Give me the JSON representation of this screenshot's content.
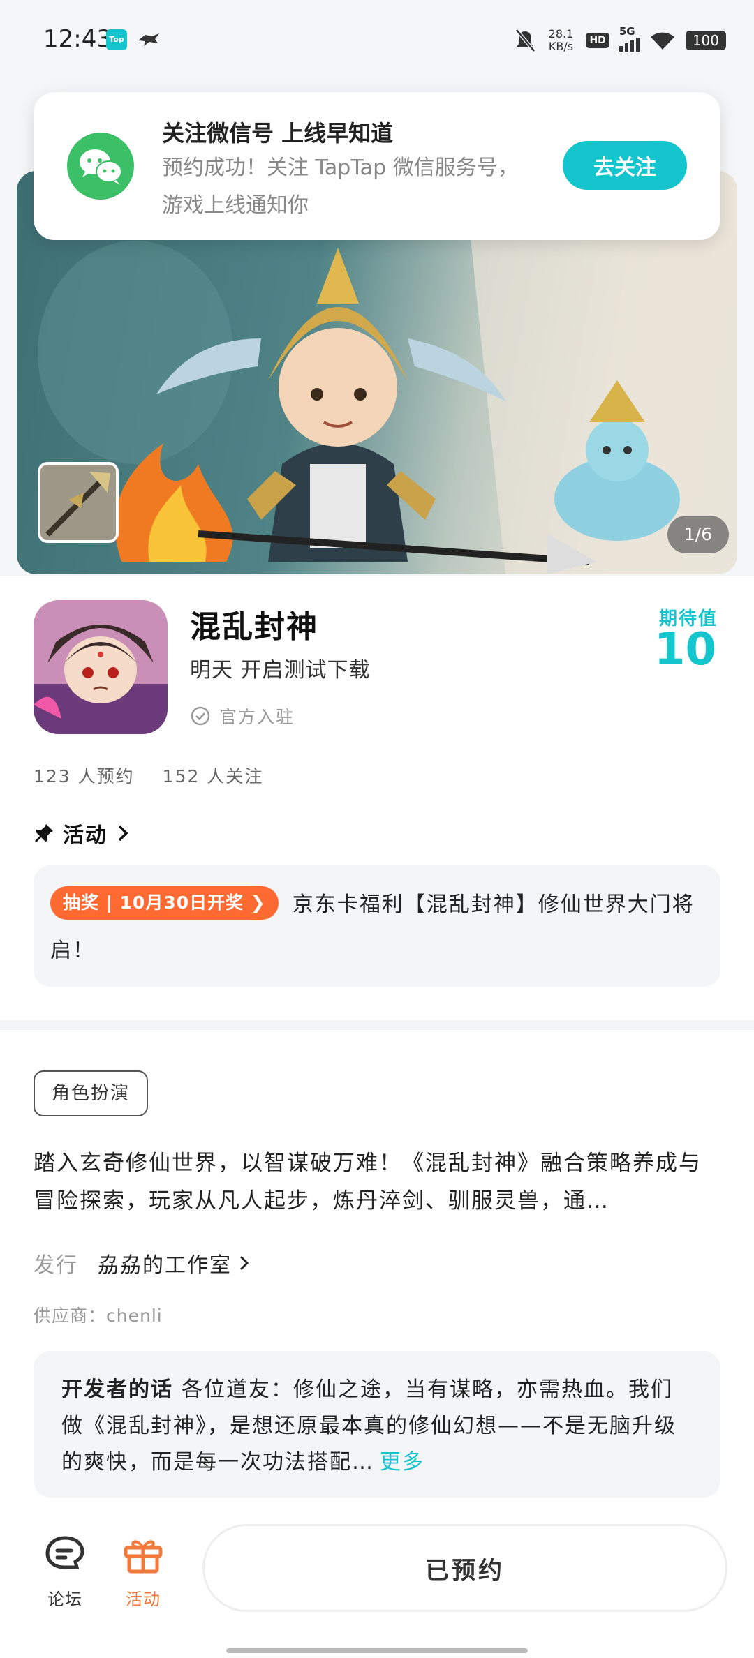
{
  "status_bar": {
    "time": "12:43",
    "app_badge": "Top",
    "net_speed_value": "28.1",
    "net_speed_unit": "KB/s",
    "hd": "HD",
    "network": "5G",
    "battery": "100"
  },
  "wechat_card": {
    "title": "关注微信号 上线早知道",
    "description": "预约成功！关注 TapTap 微信服务号，游戏上线通知你",
    "button": "去关注"
  },
  "hero": {
    "counter": "1/6"
  },
  "game": {
    "title": "混乱封神",
    "subtitle": "明天 开启测试下载",
    "official": "官方入驻",
    "expect_label": "期待值",
    "expect_value": "10",
    "reservations": "123 人预约",
    "follows": "152 人关注"
  },
  "activity": {
    "heading": "活动",
    "tag": "抽奖 | 10月30日开奖",
    "text": "京东卡福利【混乱封神】修仙世界大门将启！"
  },
  "details": {
    "genre": "角色扮演",
    "description": "踏入玄奇修仙世界，以智谋破万难！《混乱封神》融合策略养成与冒险探索，玩家从凡人起步，炼丹淬剑、驯服灵兽，通…",
    "publisher_label": "发行",
    "publisher": "劦劦的工作室",
    "supplier": "供应商：chenli"
  },
  "developer_note": {
    "label": "开发者的话",
    "text": "各位道友：修仙之途，当有谋略，亦需热血。我们做《混乱封神》，是想还原最本真的修仙幻想——不是无脑升级的爽快，而是每一次功法搭配…",
    "more": "更多"
  },
  "bottom_nav": {
    "forum": "论坛",
    "activity": "活动",
    "reserved": "已预约"
  },
  "colors": {
    "accent": "#15c5ce",
    "lottery": "#ff6a33",
    "nav_active": "#f07a3c",
    "wechat": "#3bc068"
  }
}
